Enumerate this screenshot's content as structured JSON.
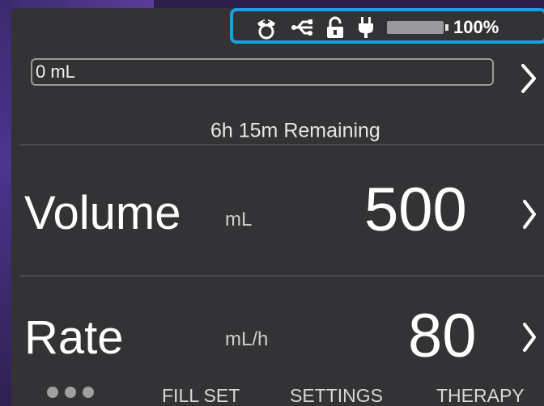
{
  "status_bar": {
    "icons": [
      "nurse-icon",
      "usb-icon",
      "lock-icon",
      "power-plug-icon",
      "battery-icon"
    ],
    "battery_level": 100,
    "battery_text": "100%"
  },
  "infusion_progress": {
    "delivered": "0 mL",
    "remaining": "6h 15m  Remaining"
  },
  "volume": {
    "label": "Volume",
    "unit": "mL",
    "value": "500"
  },
  "rate": {
    "label": "Rate",
    "unit": "mL/h",
    "value": "80"
  },
  "bottom_nav": {
    "items": [
      "FILL SET",
      "SETTINGS",
      "THERAPY"
    ]
  },
  "colors": {
    "screen_bg": "#333335",
    "highlight": "#1aa0e0",
    "text": "#ffffff"
  }
}
